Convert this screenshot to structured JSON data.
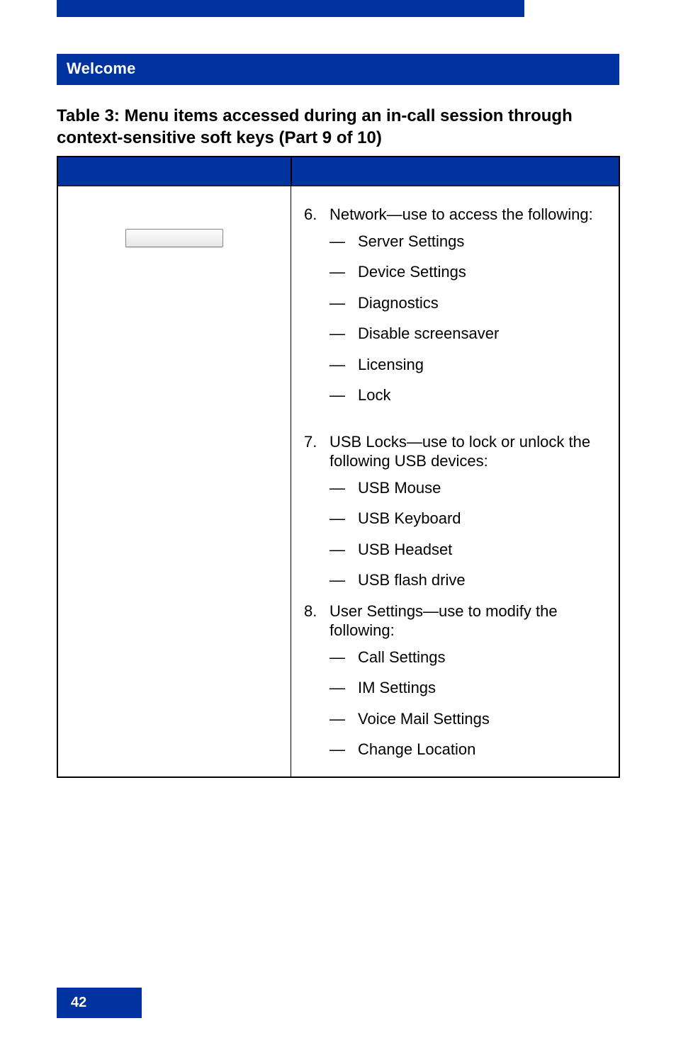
{
  "section_header": "Welcome",
  "table_caption": "Table 3: Menu items accessed during an in-call session through context-sensitive soft keys (Part 9 of 10)",
  "items": {
    "item6": {
      "num": "6.",
      "text": "Network—use to access the following:",
      "sub": {
        "a": "Server Settings",
        "b": "Device Settings",
        "c": "Diagnostics",
        "d": "Disable screensaver",
        "e": "Licensing",
        "f": "Lock"
      }
    },
    "item7": {
      "num": "7.",
      "text": "USB Locks—use to lock or unlock the following USB devices:",
      "sub": {
        "a": "USB Mouse",
        "b": "USB Keyboard",
        "c": "USB Headset",
        "d": "USB flash drive"
      }
    },
    "item8": {
      "num": "8.",
      "text": "User Settings—use to modify the following:",
      "sub": {
        "a": "Call Settings",
        "b": "IM Settings",
        "c": "Voice Mail Settings",
        "d": "Change Location"
      }
    }
  },
  "dash": "—",
  "page_number": "42"
}
